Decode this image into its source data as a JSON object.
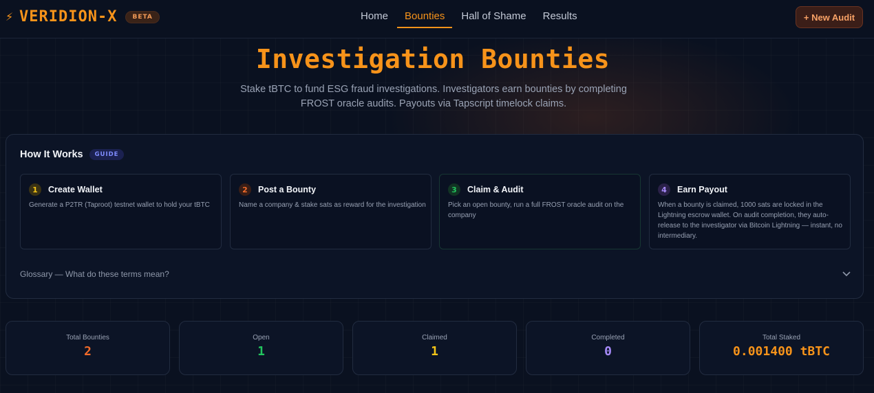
{
  "brand": {
    "name": "VERIDION-X",
    "badge": "BETA",
    "icon": "lightning-bolt-icon",
    "icon_glyph": "⚡"
  },
  "nav": {
    "items": [
      "Home",
      "Bounties",
      "Hall of Shame",
      "Results"
    ],
    "active": "Bounties"
  },
  "header": {
    "new_audit_label": "+ New Audit"
  },
  "hero": {
    "title": "Investigation Bounties",
    "subtitle": "Stake tBTC to fund ESG fraud investigations. Investigators earn bounties by completing FROST oracle audits. Payouts via Tapscript timelock claims."
  },
  "how_it_works": {
    "title": "How It Works",
    "badge": "GUIDE",
    "steps": [
      {
        "num": "1",
        "title": "Create Wallet",
        "desc": "Generate a P2TR (Taproot) testnet wallet to hold your tBTC",
        "color": "#f5c518"
      },
      {
        "num": "2",
        "title": "Post a Bounty",
        "desc": "Name a company & stake sats as reward for the investigation",
        "color": "#f26b2a"
      },
      {
        "num": "3",
        "title": "Claim & Audit",
        "desc": "Pick an open bounty, run a full FROST oracle audit on the company",
        "color": "#22c55e"
      },
      {
        "num": "4",
        "title": "Earn Payout",
        "desc": "When a bounty is claimed, 1000 sats are locked in the Lightning escrow wallet. On audit completion, they auto-release to the investigator via Bitcoin Lightning — instant, no intermediary.",
        "color": "#a78bfa"
      }
    ],
    "glossary_label": "Glossary — What do these terms mean?"
  },
  "stats": [
    {
      "label": "Total Bounties",
      "value": "2",
      "color": "#f26b2a"
    },
    {
      "label": "Open",
      "value": "1",
      "color": "#22c55e"
    },
    {
      "label": "Claimed",
      "value": "1",
      "color": "#f5c518"
    },
    {
      "label": "Completed",
      "value": "0",
      "color": "#a78bfa"
    },
    {
      "label": "Total Staked",
      "value": "0.001400 tBTC",
      "color": "#f7931a"
    }
  ],
  "colors": {
    "accent": "#f7931a",
    "background": "#0a1120"
  }
}
